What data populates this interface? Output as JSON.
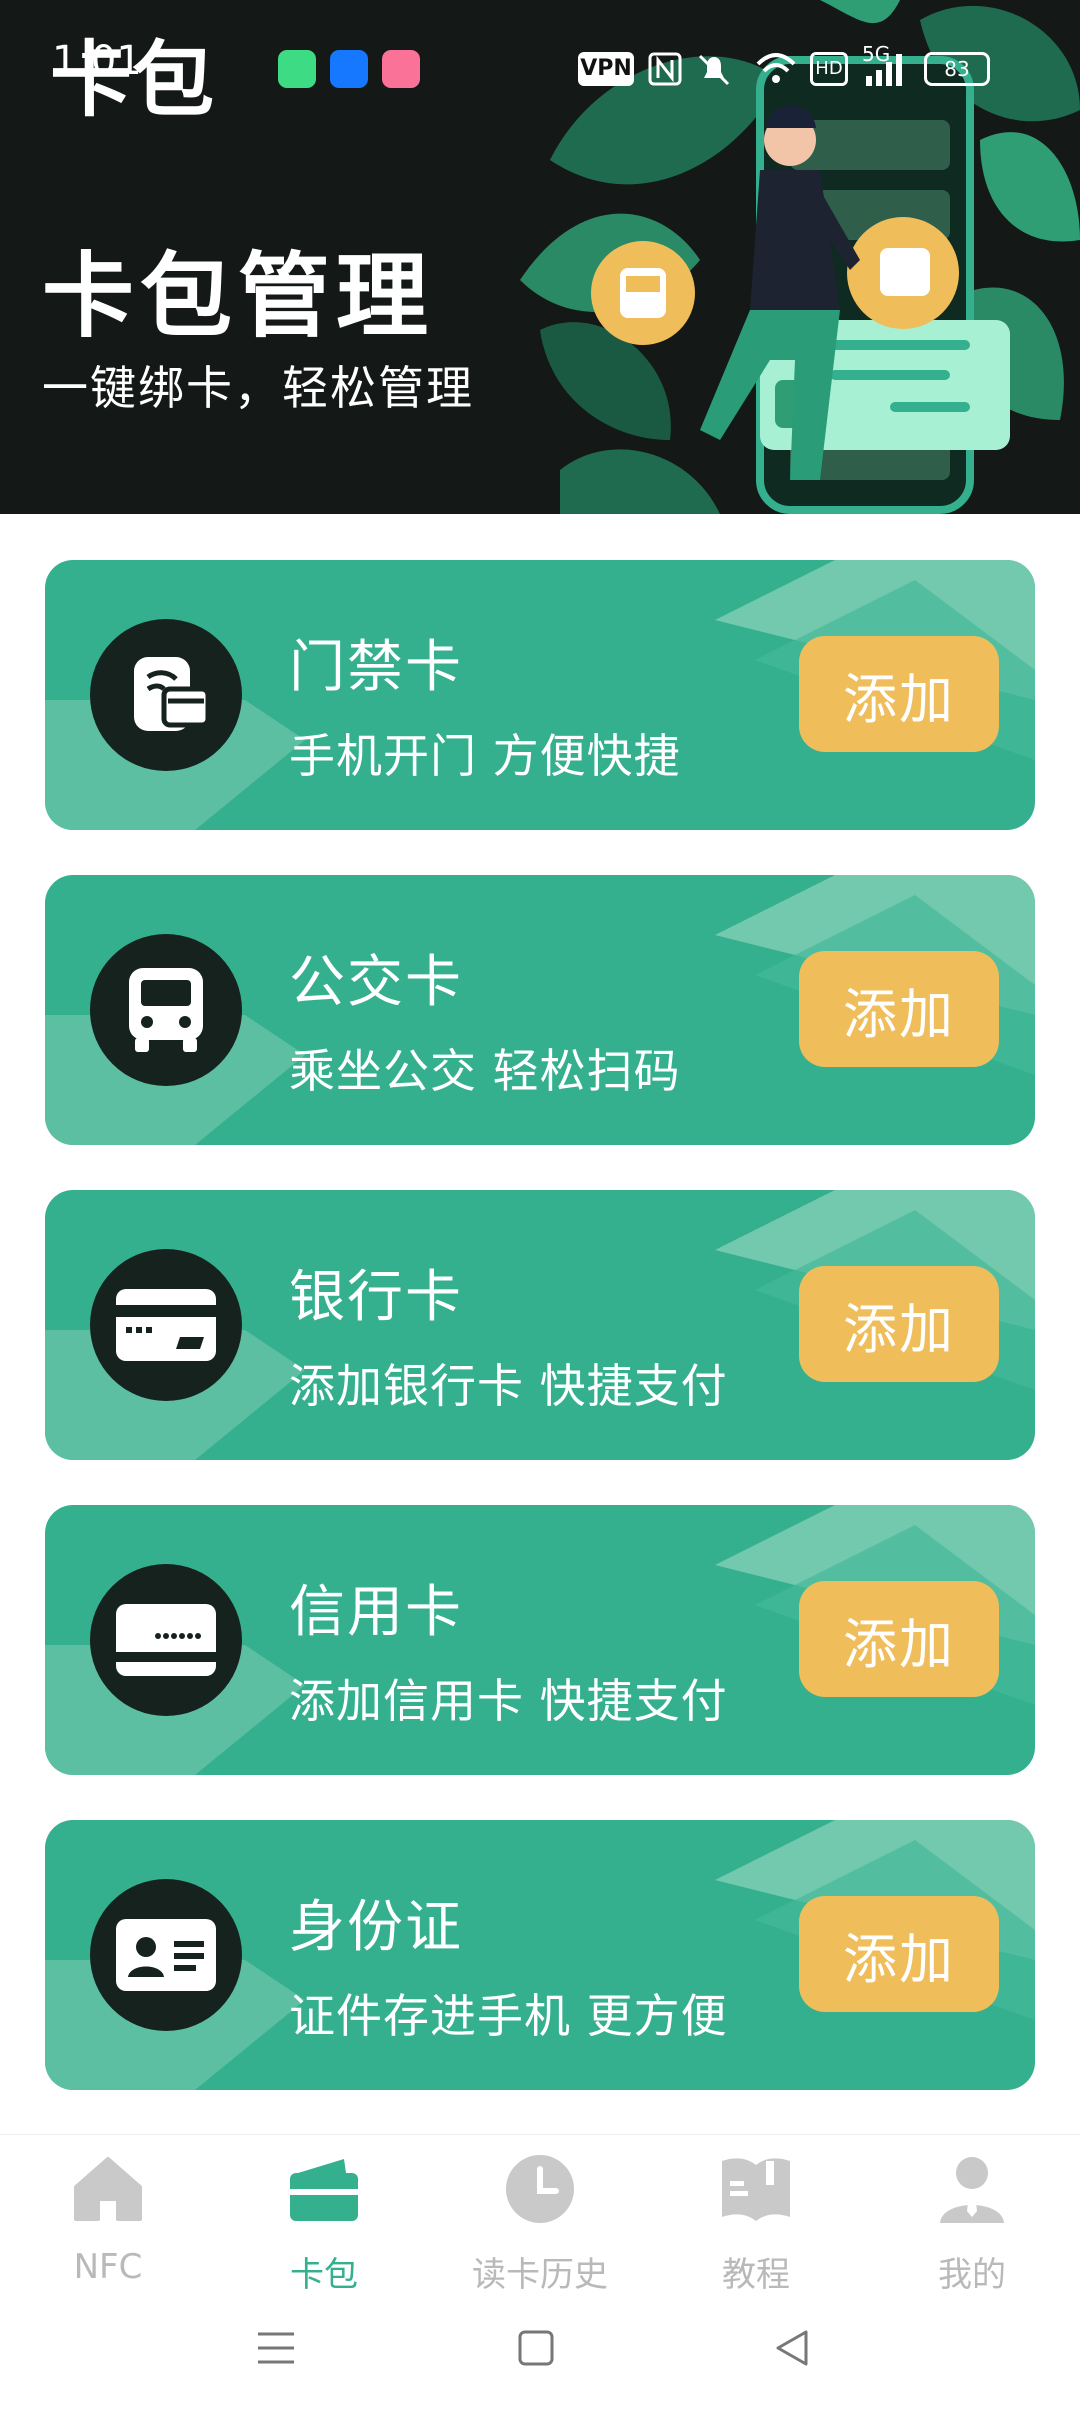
{
  "status_bar": {
    "time": "1:01",
    "vpn": "VPN",
    "battery": "83",
    "network": "5G",
    "hd": "HD"
  },
  "header": {
    "app_title": "卡包",
    "hero_title": "卡包管理",
    "hero_subtitle": "一键绑卡，轻松管理"
  },
  "cards": [
    {
      "title": "门禁卡",
      "subtitle": "手机开门  方便快捷",
      "button": "添加",
      "icon": "door-card-icon"
    },
    {
      "title": "公交卡",
      "subtitle": "乘坐公交  轻松扫码",
      "button": "添加",
      "icon": "bus-icon"
    },
    {
      "title": "银行卡",
      "subtitle": "添加银行卡  快捷支付",
      "button": "添加",
      "icon": "bank-card-icon"
    },
    {
      "title": "信用卡",
      "subtitle": "添加信用卡  快捷支付",
      "button": "添加",
      "icon": "credit-card-icon"
    },
    {
      "title": "身份证",
      "subtitle": "证件存进手机  更方便",
      "button": "添加",
      "icon": "id-card-icon"
    }
  ],
  "tabs": [
    {
      "label": "NFC",
      "icon": "home-icon",
      "active": false
    },
    {
      "label": "卡包",
      "icon": "wallet-icon",
      "active": true
    },
    {
      "label": "读卡历史",
      "icon": "clock-icon",
      "active": false
    },
    {
      "label": "教程",
      "icon": "book-icon",
      "active": false
    },
    {
      "label": "我的",
      "icon": "profile-icon",
      "active": false
    }
  ],
  "colors": {
    "primary": "#35b08f",
    "button": "#f0bd5b",
    "header_bg": "#141816",
    "icon_circle": "#16221d",
    "tab_inactive": "#b9b9b9"
  }
}
